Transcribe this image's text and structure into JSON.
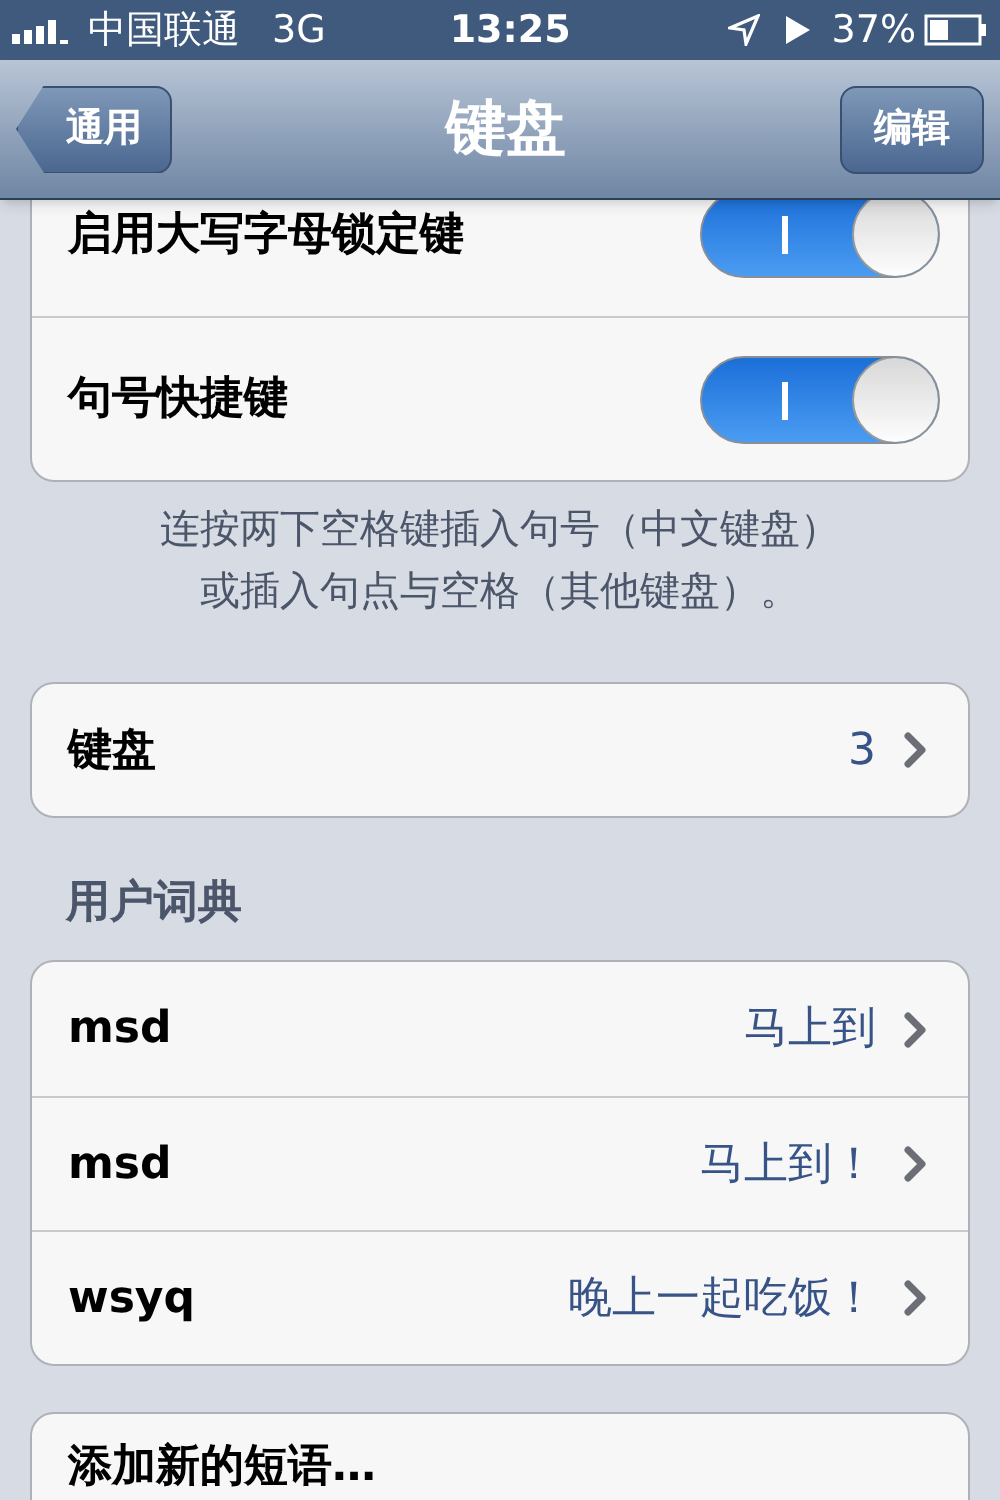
{
  "status_bar": {
    "carrier": "中国联通",
    "network": "3G",
    "time": "13:25",
    "battery": "37%"
  },
  "nav_bar": {
    "back": "通用",
    "title": "键盘",
    "action": "编辑"
  },
  "toggles": [
    {
      "label": "启用大写字母锁定键",
      "on": true
    },
    {
      "label": "句号快捷键",
      "on": true
    }
  ],
  "toggles_footer": [
    "连按两下空格键插入句号（中文键盘）",
    "或插入句点与空格（其他键盘）。"
  ],
  "keyboards_row": {
    "label": "键盘",
    "value": "3"
  },
  "dictionary": {
    "header": "用户词典",
    "entries": [
      {
        "shortcut": "msd",
        "phrase": "马上到"
      },
      {
        "shortcut": "msd",
        "phrase": "马上到！"
      },
      {
        "shortcut": "wsyq",
        "phrase": "晚上一起吃饭！"
      }
    ]
  },
  "add_phrase": "添加新的短语…"
}
